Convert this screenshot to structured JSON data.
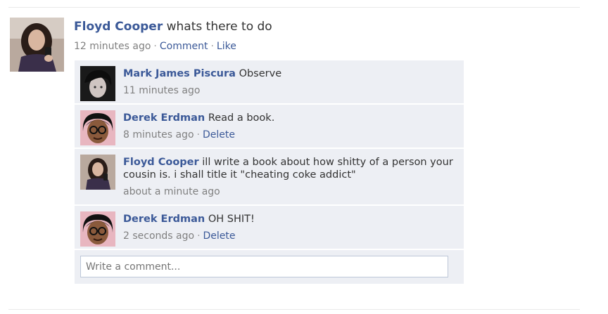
{
  "post": {
    "author": "Floyd Cooper",
    "message": "whats there to do",
    "time": "12 minutes ago",
    "comment_label": "Comment",
    "like_label": "Like",
    "separator": "·"
  },
  "comments": [
    {
      "author": "Mark James Piscura",
      "text": "Observe",
      "time": "11 minutes ago",
      "delete_label": ""
    },
    {
      "author": "Derek Erdman",
      "text": "Read a book.",
      "time": "8 minutes ago",
      "delete_label": "Delete"
    },
    {
      "author": "Floyd Cooper",
      "text_line1": "ill write a book about how shitty of a person your",
      "text_line2": "cousin is. i shall title it \"cheating coke addict\"",
      "time": "about a minute ago",
      "delete_label": ""
    },
    {
      "author": "Derek Erdman",
      "text": "OH SHIT!",
      "time": "2 seconds ago",
      "delete_label": "Delete"
    }
  ],
  "write_comment": {
    "placeholder": "Write a comment..."
  },
  "colors": {
    "link": "#3b5998",
    "comment_bg": "#edeff4",
    "meta": "#808080"
  }
}
